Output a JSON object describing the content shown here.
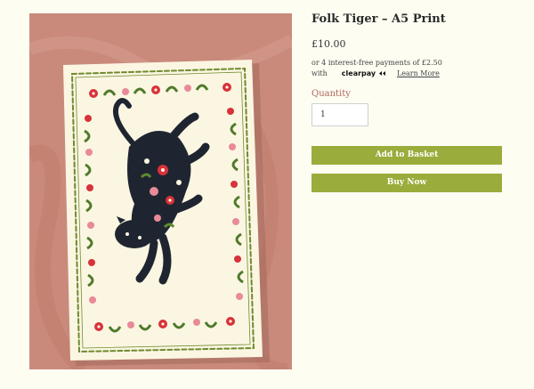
{
  "product": {
    "title": "Folk Tiger – A5 Print",
    "price": "£10.00",
    "installments_text": "or 4 interest-free payments of £2.50",
    "with_text": "with",
    "clearpay_logo": "clearpay",
    "learn_more": "Learn More"
  },
  "quantity": {
    "label": "Quantity",
    "value": "1"
  },
  "buttons": {
    "add_to_basket": "Add to Basket",
    "buy_now": "Buy Now"
  },
  "colors": {
    "accent": "#9aac3b",
    "quantity_label": "#b0655a",
    "page_background": "#fdfdf2",
    "image_background": "#c98a7c",
    "card": "#fbf6e2",
    "border_green": "#6f8a2e",
    "tiger": "#1f2530",
    "flower_red": "#d8323a",
    "flower_pink": "#e98a99"
  },
  "icons": {
    "clearpay": "clearpay-logo-icon"
  }
}
